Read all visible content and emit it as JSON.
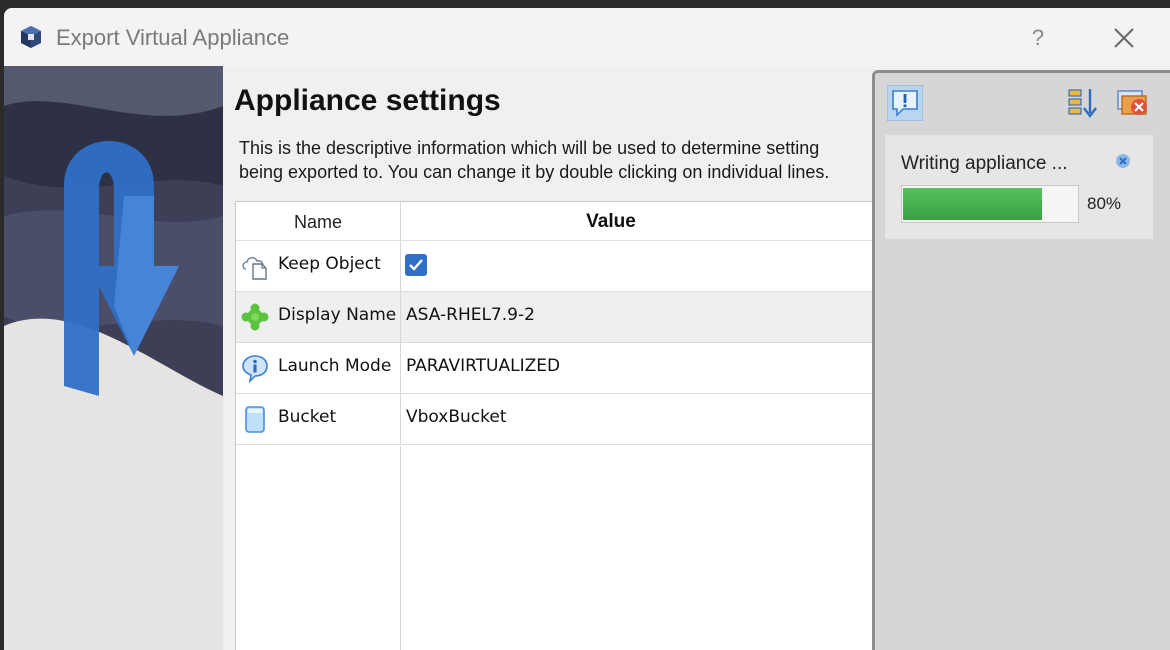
{
  "window": {
    "title": "Export Virtual Appliance",
    "help_label": "?"
  },
  "page": {
    "heading": "Appliance settings",
    "description_line1": "This is the descriptive information which will be used to determine setting",
    "description_line2": "being exported to. You can change it by double clicking on individual lines."
  },
  "table": {
    "headers": {
      "name": "Name",
      "value": "Value"
    },
    "rows": [
      {
        "label": "Keep Object",
        "value": "",
        "checked": true,
        "icon": "cloud-document-icon"
      },
      {
        "label": "Display Name",
        "value": "ASA-RHEL7.9-2",
        "icon": "green-puzzle-icon"
      },
      {
        "label": "Launch Mode",
        "value": "PARAVIRTUALIZED",
        "icon": "info-icon"
      },
      {
        "label": "Bucket",
        "value": "VboxBucket",
        "icon": "bucket-icon"
      }
    ]
  },
  "notification": {
    "message": "Writing appliance ...",
    "progress_percent": 80,
    "progress_label": "80%"
  },
  "colors": {
    "accent": "#2f6fc6",
    "progress": "#3aa043"
  }
}
